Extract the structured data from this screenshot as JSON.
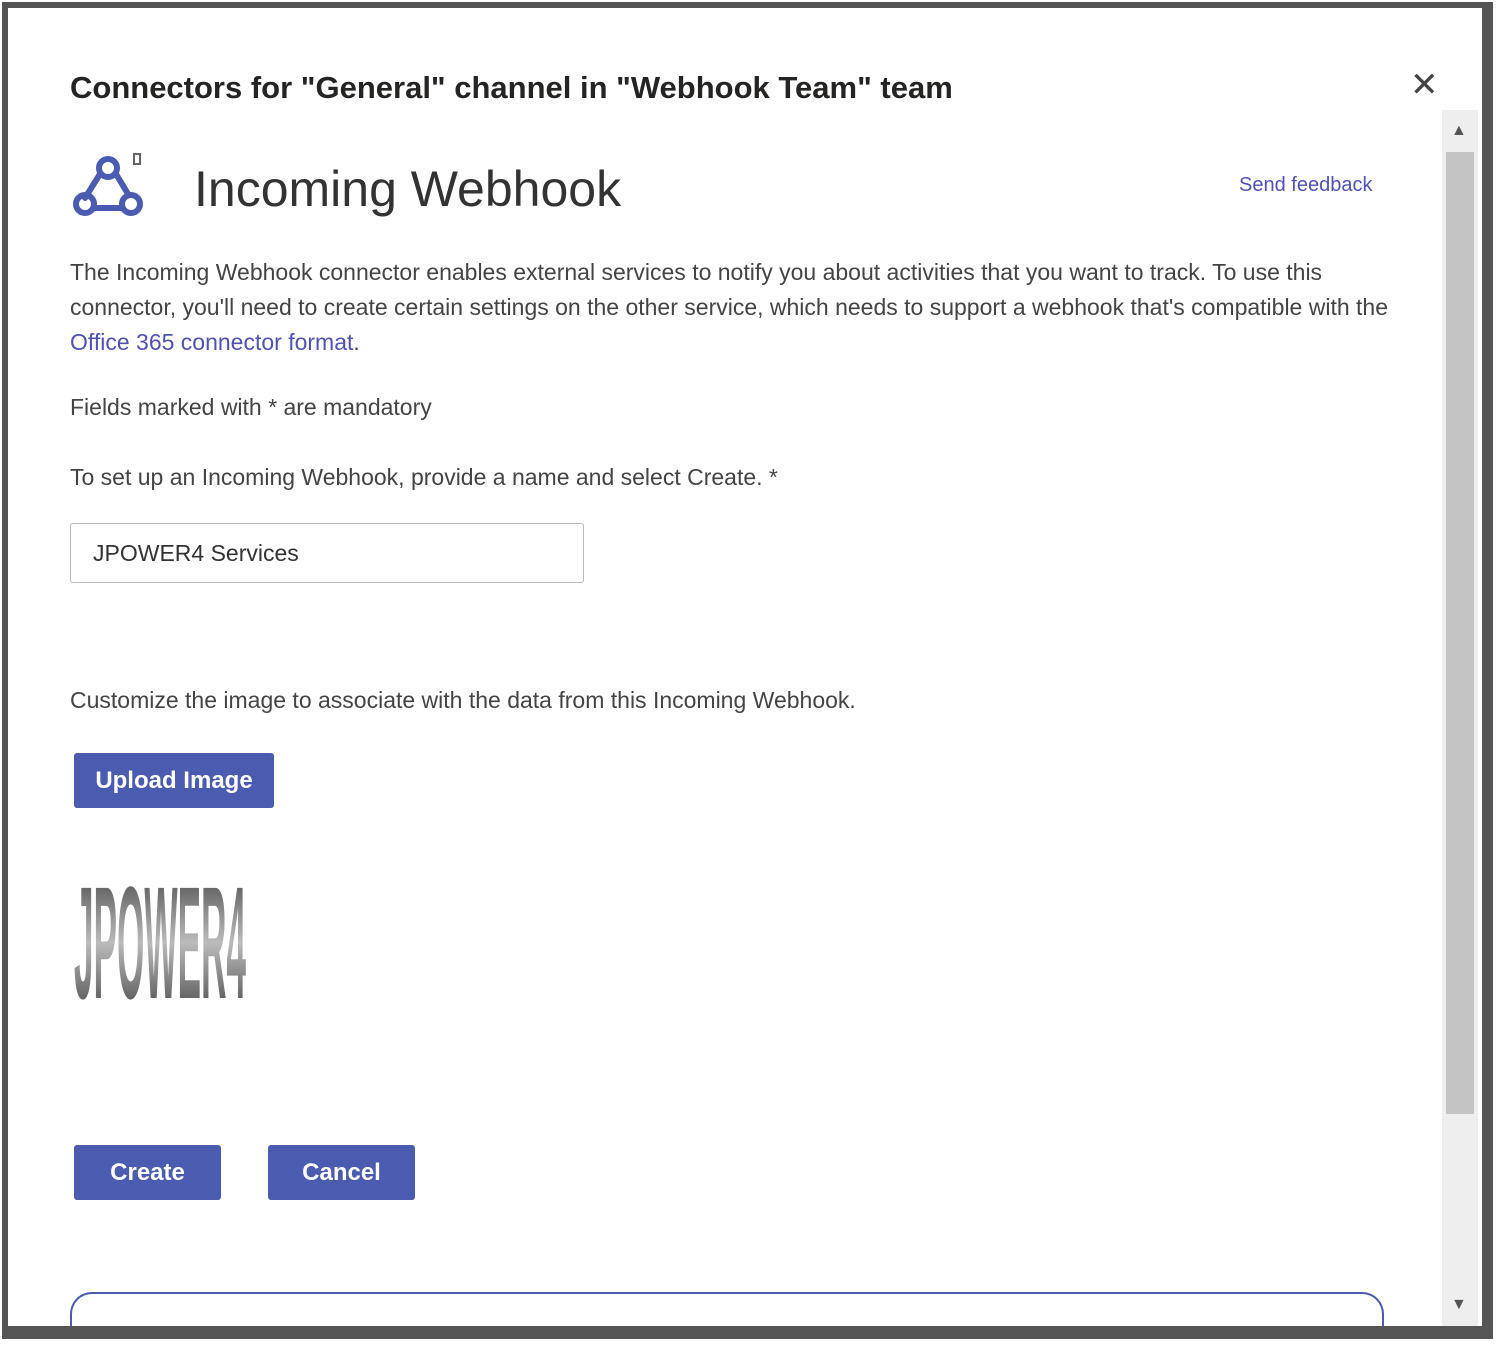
{
  "dialog": {
    "title": "Connectors for \"General\" channel in \"Webhook Team\" team",
    "close_icon": "close-icon"
  },
  "connector": {
    "icon": "webhook-icon",
    "name": "Incoming Webhook",
    "send_feedback": "Send feedback",
    "description_before_link": "The Incoming Webhook connector enables external services to notify you about activities that you want to track. To use this connector, you'll need to create certain settings on the other service, which needs to support a webhook that's compatible with the ",
    "description_link": "Office 365 connector format",
    "description_after_link": "."
  },
  "form": {
    "mandatory_note": "Fields marked with * are mandatory",
    "name_prompt": "To set up an Incoming Webhook, provide a name and select Create. *",
    "name_value": "JPOWER4 Services",
    "image_prompt": "Customize the image to associate with the data from this Incoming Webhook.",
    "upload_label": "Upload Image",
    "image_logo_text": "JPOWER4",
    "create_label": "Create",
    "cancel_label": "Cancel"
  },
  "colors": {
    "accent": "#4b5cb0",
    "link": "#4f52b2"
  }
}
